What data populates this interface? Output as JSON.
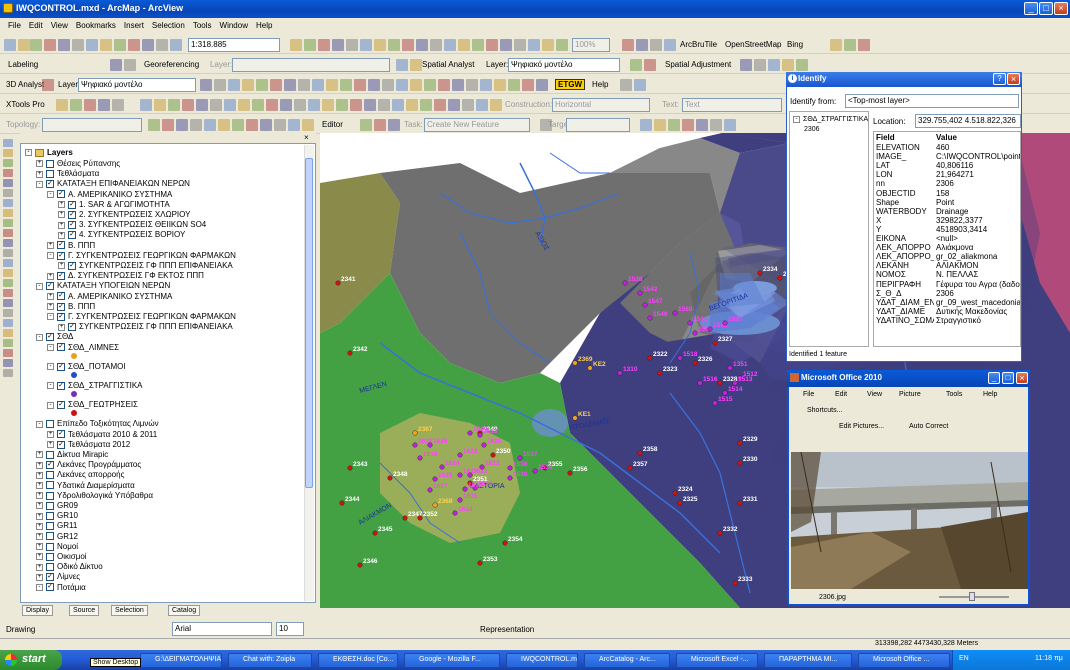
{
  "window": {
    "title": "IWQCONTROL.mxd - ArcMap - ArcView"
  },
  "menu": [
    "File",
    "Edit",
    "View",
    "Bookmarks",
    "Insert",
    "Selection",
    "Tools",
    "Window",
    "Help"
  ],
  "toolbar": {
    "scale": "1:318.885",
    "zoom": "100%",
    "arctoolbox": "ArcBruTile",
    "osm": "OpenStreetMap",
    "bing": "Bing"
  },
  "toolbar2": {
    "labeling": "Labeling",
    "georef": "Georeferencing",
    "layer_label": "Layer:",
    "spatial_analyst": "Spatial Analyst",
    "layer2_label": "Layer:",
    "layer2_value": "Ψηφιακό μοντέλο",
    "spatial_adj": "Spatial Adjustment"
  },
  "toolbar3": {
    "three_d": "3D Analyst",
    "layer_label": "Layer:",
    "layer_value": "Ψηφιακό μοντέλο",
    "etgw": "ETGW",
    "help": "Help"
  },
  "toolbar4": {
    "xtools": "XTools Pro",
    "construction": "Construction:",
    "construction_value": "Horizontal",
    "text": "Text:",
    "text_value": "Text"
  },
  "toolbar5": {
    "topology": "Topology:",
    "editor": "Editor",
    "task": "Task:",
    "task_value": "Create New Feature",
    "target": "Target:"
  },
  "toc": {
    "root": "Layers",
    "rows": [
      {
        "indent": 1,
        "ex": "+",
        "cb": false,
        "label": "Θέσεις Ρύπανσης"
      },
      {
        "indent": 1,
        "ex": "+",
        "cb": false,
        "label": "Τεθλάσματα"
      },
      {
        "indent": 1,
        "ex": "-",
        "cb": true,
        "label": "ΚΑΤΑΤΑΞΗ ΕΠΙΦΑΝΕΙΑΚΩΝ ΝΕΡΩΝ"
      },
      {
        "indent": 2,
        "ex": "-",
        "cb": true,
        "label": "Α. ΑΜΕΡΙΚΑΝΙΚΟ ΣΥΣΤΗΜΑ"
      },
      {
        "indent": 3,
        "ex": "+",
        "cb": true,
        "label": "1. SAR & ΑΓΩΓΙΜΟΤΗΤΑ"
      },
      {
        "indent": 3,
        "ex": "+",
        "cb": true,
        "label": "2. ΣΥΓΚΕΝΤΡΩΣΕΙΣ ΧΛΩΡΙΟΥ"
      },
      {
        "indent": 3,
        "ex": "+",
        "cb": true,
        "label": "3. ΣΥΓΚΕΝΤΡΩΣΕΙΣ ΘΕΙΙΚΩΝ SO4"
      },
      {
        "indent": 3,
        "ex": "+",
        "cb": true,
        "label": "4. ΣΥΓΚΕΝΤΡΩΣΕΙΣ ΒΟΡΙΟΥ"
      },
      {
        "indent": 2,
        "ex": "+",
        "cb": true,
        "label": "Β. ΠΠΠ"
      },
      {
        "indent": 2,
        "ex": "-",
        "cb": true,
        "label": "Γ. ΣΥΓΚΕΝΤΡΩΣΕΙΣ ΓΕΩΡΓΙΚΩΝ ΦΑΡΜΑΚΩΝ"
      },
      {
        "indent": 3,
        "ex": "+",
        "cb": true,
        "label": "ΣΥΓΚΕΝΤΡΩΣΕΙΣ ΓΦ ΠΠΠ ΕΠΙΦΑΝΕΙΑΚΑ"
      },
      {
        "indent": 2,
        "ex": "+",
        "cb": true,
        "label": "Δ. ΣΥΓΚΕΝΤΡΩΣΕΙΣ ΓΦ ΕΚΤΟΣ ΠΠΠ"
      },
      {
        "indent": 1,
        "ex": "-",
        "cb": true,
        "label": "ΚΑΤΑΤΑΞΗ ΥΠΟΓΕΙΩΝ ΝΕΡΩΝ"
      },
      {
        "indent": 2,
        "ex": "+",
        "cb": true,
        "label": "Α. ΑΜΕΡΙΚΑΝΙΚΟ ΣΥΣΤΗΜΑ"
      },
      {
        "indent": 2,
        "ex": "+",
        "cb": true,
        "label": "Β. ΠΠΠ"
      },
      {
        "indent": 2,
        "ex": "-",
        "cb": true,
        "label": "Γ. ΣΥΓΚΕΝΤΡΩΣΕΙΣ ΓΕΩΡΓΙΚΩΝ ΦΑΡΜΑΚΩΝ"
      },
      {
        "indent": 3,
        "ex": "+",
        "cb": true,
        "label": "ΣΥΓΚΕΝΤΡΩΣΕΙΣ ΓΦ ΠΠΠ ΕΠΙΦΑΝΕΙΑΚΑ"
      },
      {
        "indent": 1,
        "ex": "-",
        "cb": true,
        "label": "ΣΘΔ"
      },
      {
        "indent": 2,
        "ex": "-",
        "cb": true,
        "label": "ΣΘΔ_ΛΙΜΝΕΣ"
      },
      {
        "indent": 2,
        "ex": "-",
        "cb": true,
        "label": "ΣΘΔ_ΠΟΤΑΜΟΙ"
      },
      {
        "indent": 2,
        "ex": "-",
        "cb": true,
        "label": "ΣΘΔ_ΣΤΡΑΓΓΙΣΤΙΚΑ"
      },
      {
        "indent": 2,
        "ex": "-",
        "cb": true,
        "label": "ΣΘΔ_ΓΕΩΤΡΗΣΕΙΣ"
      },
      {
        "indent": 1,
        "ex": "-",
        "cb": false,
        "label": "Επίπεδο Τοξικότητας Λιμνών"
      },
      {
        "indent": 2,
        "ex": "+",
        "cb": true,
        "label": "Τεθλάσματα 2010 & 2011"
      },
      {
        "indent": 2,
        "ex": "+",
        "cb": true,
        "label": "Τεθλάσματα 2012"
      },
      {
        "indent": 1,
        "ex": "+",
        "cb": false,
        "label": "Δίκτυα Mirapic"
      },
      {
        "indent": 1,
        "ex": "+",
        "cb": true,
        "label": "Λεκάνες Προγράμματος"
      },
      {
        "indent": 1,
        "ex": "+",
        "cb": false,
        "label": "Λεκάνες απορροής"
      },
      {
        "indent": 1,
        "ex": "+",
        "cb": false,
        "label": "Υδατικά Διαμερίσματα"
      },
      {
        "indent": 1,
        "ex": "+",
        "cb": false,
        "label": "Υδρολιθολογικά Υπόβαθρα"
      },
      {
        "indent": 1,
        "ex": "+",
        "cb": false,
        "label": "GR09"
      },
      {
        "indent": 1,
        "ex": "+",
        "cb": false,
        "label": "GR10"
      },
      {
        "indent": 1,
        "ex": "+",
        "cb": false,
        "label": "GR11"
      },
      {
        "indent": 1,
        "ex": "+",
        "cb": false,
        "label": "GR12"
      },
      {
        "indent": 1,
        "ex": "+",
        "cb": false,
        "label": "Νομοί"
      },
      {
        "indent": 1,
        "ex": "+",
        "cb": false,
        "label": "Οικισμοί"
      },
      {
        "indent": 1,
        "ex": "+",
        "cb": false,
        "label": "Οδικό Δίκτυο"
      },
      {
        "indent": 1,
        "ex": "+",
        "cb": true,
        "label": "Λίμνες"
      },
      {
        "indent": 1,
        "ex": "-",
        "cb": true,
        "label": "Ποτάμια"
      }
    ],
    "tabs": [
      "Display",
      "Source",
      "Selection",
      "Catalog"
    ]
  },
  "map": {
    "river_names": [
      "ΑΞΙΟΣ",
      "ΜΕΓΛΕΝ",
      "ΑΛΙΑΚΜΟΝ"
    ],
    "lake_names": [
      "ΒΕΓΟΡΙΤΙΔΑ",
      "ΠΤΟΛΕΜΑΪΣ",
      "ΚΑΣΤΟΡΙΑ"
    ],
    "magenta_labels": [
      "1628",
      "1626",
      "1619",
      "1624",
      "1625",
      "1627",
      "1622",
      "1617",
      "1621",
      "1623",
      "1618",
      "1616",
      "1620",
      "1629",
      "1613",
      "1615",
      "1614",
      "1530",
      "1536",
      "1537",
      "1539",
      "1538",
      "1542",
      "1547",
      "1549",
      "1560",
      "1541",
      "1591",
      "1592",
      "1593",
      "1351",
      "1512",
      "1513",
      "1514",
      "1515",
      "1516",
      "1518",
      "1310"
    ],
    "red_labels": [
      "2341",
      "2342",
      "2343",
      "2344",
      "2345",
      "2346",
      "2347",
      "2348",
      "2349",
      "2350",
      "2351",
      "2352",
      "2353",
      "2354",
      "2355",
      "2356",
      "2357",
      "2358",
      "2322",
      "2323",
      "2324",
      "2325",
      "2326",
      "2327",
      "2328",
      "2329",
      "2330",
      "2331",
      "2332",
      "2333",
      "2334",
      "2335",
      "2336"
    ],
    "orange_labels": [
      "2367",
      "2368",
      "2369",
      "ΚΕ1",
      "ΚΕ2"
    ]
  },
  "identify": {
    "title": "Identify",
    "from_label": "Identify from:",
    "from_value": "<Top-most layer>",
    "tree_root": "ΣΘΔ_ΣΤΡΑΓΓΙΣΤΙΚΑ",
    "tree_child": "2306",
    "location_label": "Location:",
    "location_value": "329.755,402  4.518.822,326",
    "col_field": "Field",
    "col_value": "Value",
    "rows": [
      [
        "ELEVATION",
        "460"
      ],
      [
        "IMAGE_",
        "C:\\IWQCONTROL\\point_photo"
      ],
      [
        "LAT",
        "40,806116"
      ],
      [
        "LON",
        "21,964271"
      ],
      [
        "nn",
        "2306"
      ],
      [
        "OBJECTID",
        "158"
      ],
      [
        "Shape",
        "Point"
      ],
      [
        "WATERBODY",
        "Drainage"
      ],
      [
        "X",
        "329822,3377"
      ],
      [
        "Y",
        "4518903,3414"
      ],
      [
        "ΕΙΚΟΝΑ",
        "<null>"
      ],
      [
        "ΛΕΚ_ΑΠΟΡΡΟ",
        "Αλιάκμονα"
      ],
      [
        "ΛΕΚ_ΑΠΟΡΡΟ_EN",
        "gr_02_aliakmona"
      ],
      [
        "ΛΕΚΑΝΗ",
        "ΑΛΙΑΚΜΟΝ"
      ],
      [
        "ΝΟΜΟΣ",
        "Ν. ΠΕΛΛΑΣ"
      ],
      [
        "ΠΕΡΙΓΡΑΦΗ",
        "Γέφυρα του Αγρα (δαδο)αναν"
      ],
      [
        "Σ_Θ_Δ",
        "2306"
      ],
      [
        "ΥΔΑΤ_ΔΙΑΜ_EN",
        "gr_09_west_macedonia"
      ],
      [
        "ΥΔΑΤ_ΔΙΑΜΕ",
        "Δυτικής Μακεδονίας"
      ],
      [
        "ΥΔΑΤΙΝΟ_ΣΩΜΑ",
        "Στραγγιστικό"
      ]
    ],
    "status": "Identified 1 feature"
  },
  "office": {
    "title": "Microsoft Office 2010",
    "menu": [
      "File",
      "Edit",
      "View",
      "Picture",
      "Tools",
      "Help"
    ],
    "shortcuts": "Shortcuts...",
    "edit_pictures": "Edit Pictures...",
    "auto_correct": "Auto Correct",
    "filename": "2306.jpg"
  },
  "drawing": {
    "drawing": "Drawing",
    "font": "Arial",
    "size": "10",
    "representation": "Representation"
  },
  "statusbar": {
    "coords": "313398,282  4473430,328 Meters"
  },
  "taskbar": {
    "start": "start",
    "tooltip": "Show Desktop",
    "tasks": [
      "G:\\ΔΕΙΓΜΑΤΟΛΗΨΙΑ\\SSS...",
      "Chat with: Zoipla",
      "ΕΚΘΕΣΗ.doc [Co...",
      "Google - Mozilla F...",
      "IWQCONTROL.m...",
      "ArcCatalog - Arc...",
      "Microsoft Excel -...",
      "ΠΑΡΑΡΤΗΜΑ ΜΙ...",
      "Microsoft Office ..."
    ],
    "lang": "EN",
    "clock": "11:18 πμ"
  }
}
